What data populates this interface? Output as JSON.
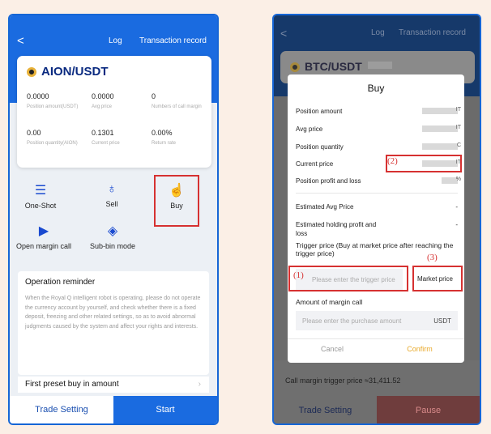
{
  "left": {
    "header": {
      "back": "<",
      "log": "Log",
      "transaction_record": "Transaction record"
    },
    "card": {
      "pair": "AION/USDT",
      "stats": [
        {
          "value": "0.0000",
          "label": "Position amount(USDT)"
        },
        {
          "value": "0.0000",
          "label": "Avg price"
        },
        {
          "value": "0",
          "label": "Numbers of call margin"
        },
        {
          "value": "0.00",
          "label": "Position quantity(AION)"
        },
        {
          "value": "0.1301",
          "label": "Current price"
        },
        {
          "value": "0.00%",
          "label": "Return rate"
        }
      ]
    },
    "actions": {
      "one_shot": "One-Shot",
      "sell": "Sell",
      "buy": "Buy",
      "open_margin_call": "Open margin call",
      "sub_bin_mode": "Sub-bin mode"
    },
    "reminder": {
      "title": "Operation reminder",
      "body": "When the Royal Q intelligent robot is operating, please do not operate the currency account by yourself, and check whether there is a fixed deposit, freezing and other related settings, so as to avoid abnormal judgments caused by the system and affect your rights and interests."
    },
    "first_preset": "First preset buy in amount",
    "bottom": {
      "trade_setting": "Trade Setting",
      "start": "Start"
    }
  },
  "right": {
    "header": {
      "back": "<",
      "log": "Log",
      "transaction_record": "Transaction record"
    },
    "bg_pair": "BTC/USDT",
    "dialog": {
      "title": "Buy",
      "rows": [
        {
          "label": "Position amount",
          "suffix": "IT"
        },
        {
          "label": "Avg price",
          "suffix": "IT"
        },
        {
          "label": "Position quantity",
          "suffix": "C"
        },
        {
          "label": "Current price",
          "suffix": "IT"
        },
        {
          "label": "Position profit and loss",
          "suffix": "%"
        }
      ],
      "estimated_avg": "Estimated Avg Price",
      "estimated_avg_val": "-",
      "estimated_hold": "Estimated holding profit and loss",
      "estimated_hold_val": "-",
      "trigger_label": "Trigger price (Buy at market price after reaching the trigger price)",
      "trigger_placeholder": "Please enter the trigger price",
      "market_price": "Market price",
      "margin_label": "Amount of margin call",
      "margin_placeholder": "Please enter the purchase amount",
      "margin_unit": "USDT",
      "cancel": "Cancel",
      "confirm": "Confirm"
    },
    "annotations": {
      "a1": "(1)",
      "a2": "(2)",
      "a3": "(3)"
    },
    "bg_bottom": {
      "trigger": "Call margin trigger price  ≈31,411.52",
      "trade_setting": "Trade Setting",
      "pause": "Pause"
    }
  }
}
